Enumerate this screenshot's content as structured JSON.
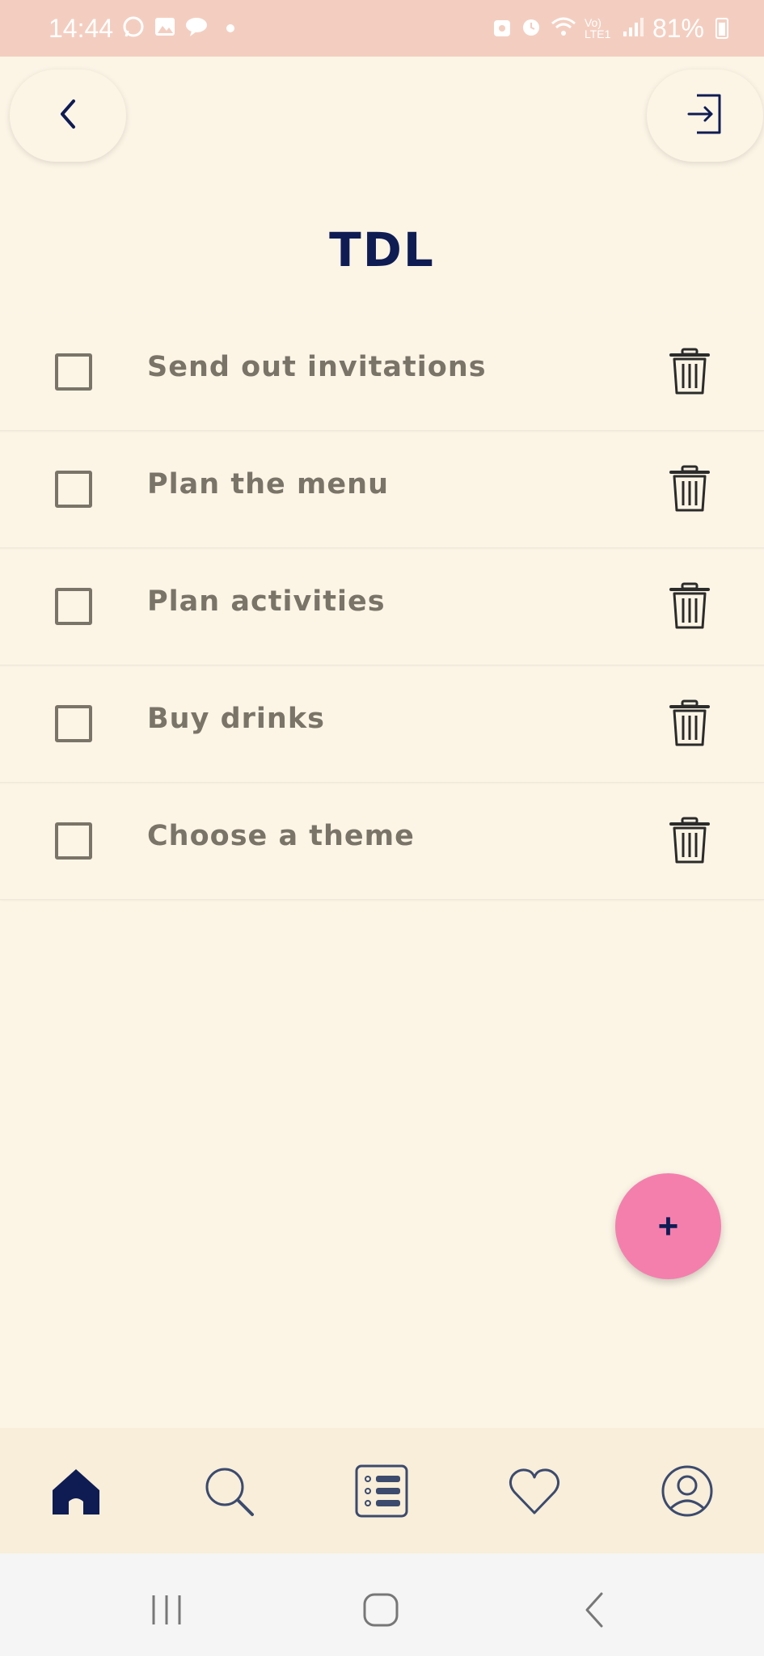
{
  "status_bar": {
    "time": "14:44",
    "battery": "81%",
    "network": "Vo) LTE1",
    "left_icons": [
      "whatsapp-icon",
      "image-icon",
      "chat-icon",
      "dot-icon"
    ],
    "right_icons": [
      "vpn-icon",
      "alarm-icon",
      "wifi-icon",
      "signal-icon",
      "battery-icon"
    ]
  },
  "header": {
    "title": "TDL",
    "back_icon": "chevron-left-icon",
    "logout_icon": "exit-icon"
  },
  "tasks": [
    {
      "label": "Send out invitations",
      "checked": false
    },
    {
      "label": "Plan the menu",
      "checked": false
    },
    {
      "label": "Plan activities",
      "checked": false
    },
    {
      "label": "Buy drinks",
      "checked": false
    },
    {
      "label": "Choose a theme",
      "checked": false
    }
  ],
  "fab": {
    "label": "+"
  },
  "bottom_nav": {
    "items": [
      {
        "icon": "home-icon",
        "active": true
      },
      {
        "icon": "search-icon",
        "active": false
      },
      {
        "icon": "list-icon",
        "active": false
      },
      {
        "icon": "heart-icon",
        "active": false
      },
      {
        "icon": "profile-icon",
        "active": false
      }
    ]
  },
  "system_nav": {
    "items": [
      "recent-apps-icon",
      "home-circle-icon",
      "back-icon"
    ]
  },
  "colors": {
    "background": "#fcf5e6",
    "status_bar": "#f3cec0",
    "title": "#0f1c54",
    "task_text": "#7a7468",
    "fab": "#f47fad",
    "bottom_nav": "#f8eed9"
  }
}
